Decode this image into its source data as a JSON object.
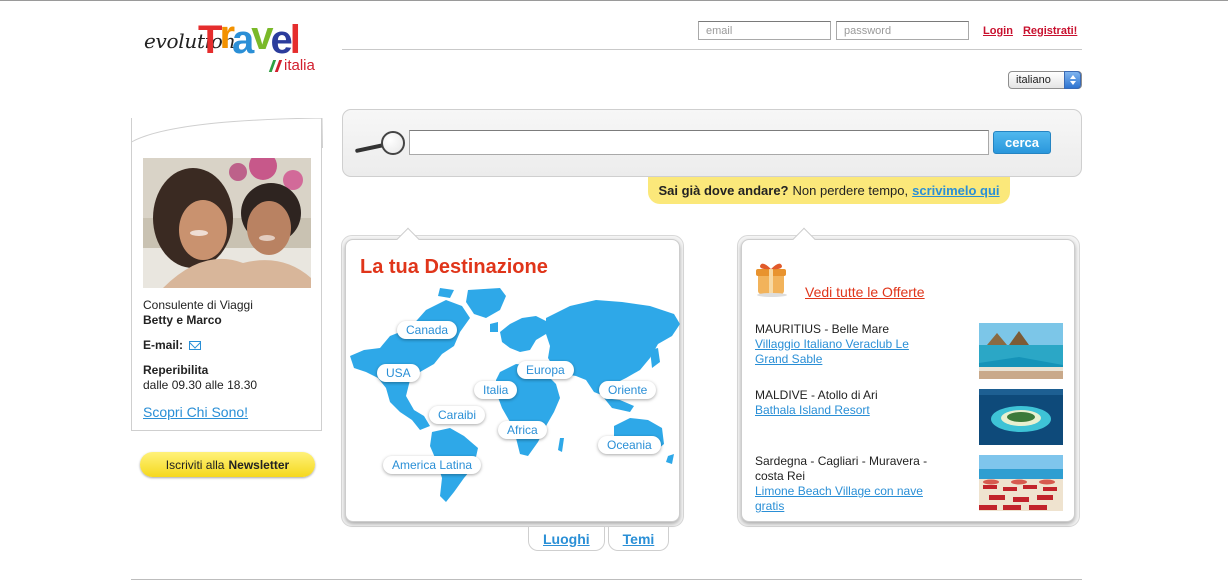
{
  "logo": {
    "evolution": "evolution",
    "travel_letters": [
      "T",
      "r",
      "a",
      "v",
      "e",
      "l"
    ],
    "country": "italia"
  },
  "header": {
    "email_placeholder": "email",
    "password_placeholder": "password",
    "login_label": "Login",
    "register_label": "Registrati!"
  },
  "language": {
    "selected": "italiano"
  },
  "consultant": {
    "role": "Consulente di Viaggi",
    "name": "Betty e Marco",
    "email_label": "E-mail:",
    "availability_label": "Reperibilita",
    "availability_hours": "dalle 09.30 alle 18.30",
    "more_link": "Scopri Chi Sono!"
  },
  "newsletter": {
    "prefix": "Iscriviti alla",
    "strong": "Newsletter"
  },
  "search": {
    "button_label": "cerca",
    "query": ""
  },
  "tip": {
    "question": "Sai già dove andare?",
    "text": "Non perdere tempo,",
    "link": "scrivimelo qui"
  },
  "destination": {
    "title": "La tua Destinazione",
    "regions": {
      "canada": "Canada",
      "usa": "USA",
      "italia": "Italia",
      "europa": "Europa",
      "oriente": "Oriente",
      "caraibi": "Caraibi",
      "africa": "Africa",
      "oceania": "Oceania",
      "america_latina": "America Latina"
    },
    "tabs": {
      "places": "Luoghi",
      "themes": "Temi"
    }
  },
  "offers": {
    "all_link": "Vedi tutte le Offerte",
    "items": [
      {
        "destination": "MAURITIUS - Belle Mare",
        "hotel": "Villaggio Italiano Veraclub Le Grand Sable"
      },
      {
        "destination": "MALDIVE - Atollo di Ari",
        "hotel": "Bathala Island Resort"
      },
      {
        "destination": "Sardegna - Cagliari - Muravera - costa Rei",
        "hotel": "Limone Beach Village con nave gratis"
      }
    ]
  },
  "colors": {
    "accent_blue": "#2a8fd6",
    "accent_red": "#e0351a",
    "tip_yellow": "#fbe87a",
    "map_blue": "#2ea8e8"
  }
}
